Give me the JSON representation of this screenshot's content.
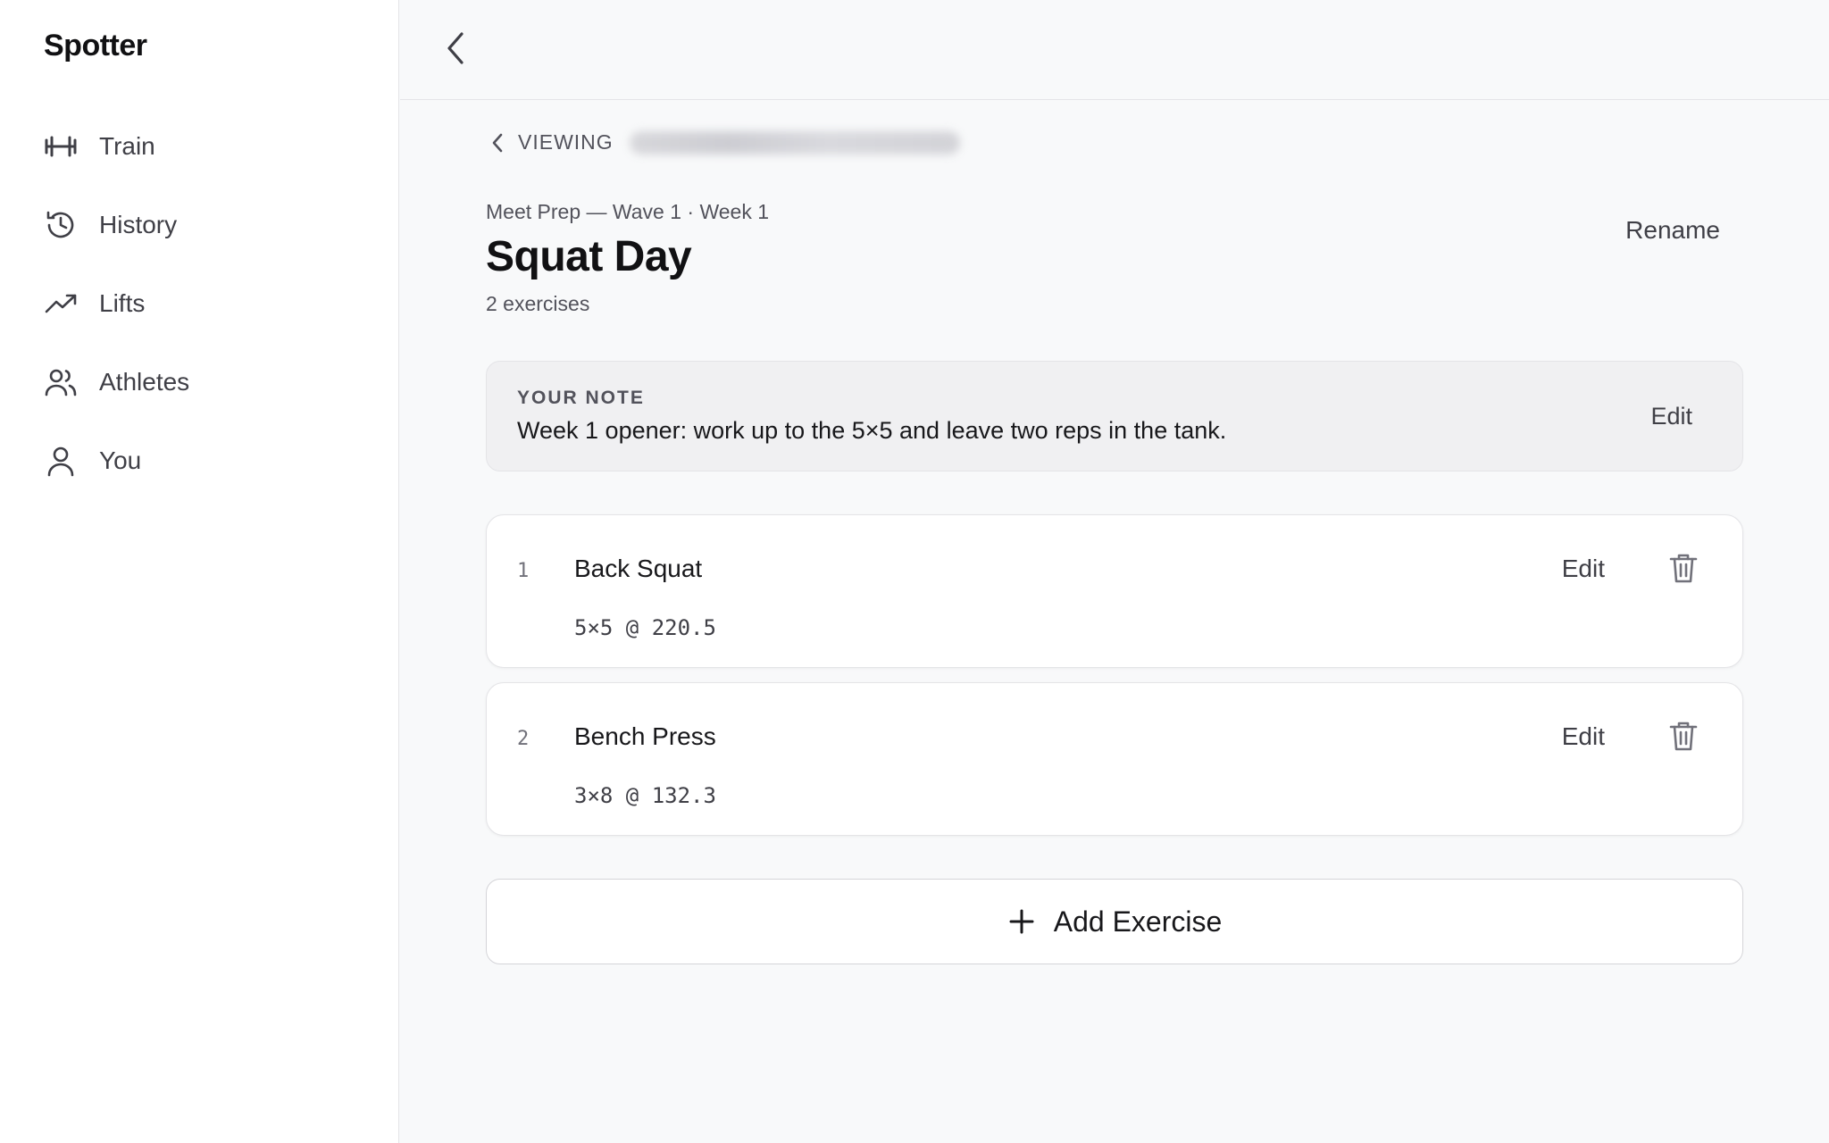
{
  "app": {
    "brand": "Spotter"
  },
  "sidebar": {
    "items": [
      {
        "label": "Train",
        "icon": "dumbbell-icon"
      },
      {
        "label": "History",
        "icon": "history-icon"
      },
      {
        "label": "Lifts",
        "icon": "trending-up-icon"
      },
      {
        "label": "Athletes",
        "icon": "users-icon"
      },
      {
        "label": "You",
        "icon": "user-icon"
      }
    ]
  },
  "header": {
    "viewing_label": "VIEWING",
    "breadcrumb": "Meet Prep — Wave 1 · Week 1",
    "title": "Squat Day",
    "exercise_count": "2 exercises",
    "rename_label": "Rename"
  },
  "note": {
    "label": "YOUR NOTE",
    "text": "Week 1 opener: work up to the 5×5 and leave two reps in the tank.",
    "edit_label": "Edit"
  },
  "exercises": [
    {
      "index": "1",
      "name": "Back Squat",
      "detail": "5×5 @ 220.5",
      "edit_label": "Edit"
    },
    {
      "index": "2",
      "name": "Bench Press",
      "detail": "3×8 @ 132.3",
      "edit_label": "Edit"
    }
  ],
  "add_button": {
    "label": "Add Exercise"
  },
  "colors": {
    "accent": "#18181b",
    "muted": "#52525b",
    "border": "#e4e4e7"
  }
}
